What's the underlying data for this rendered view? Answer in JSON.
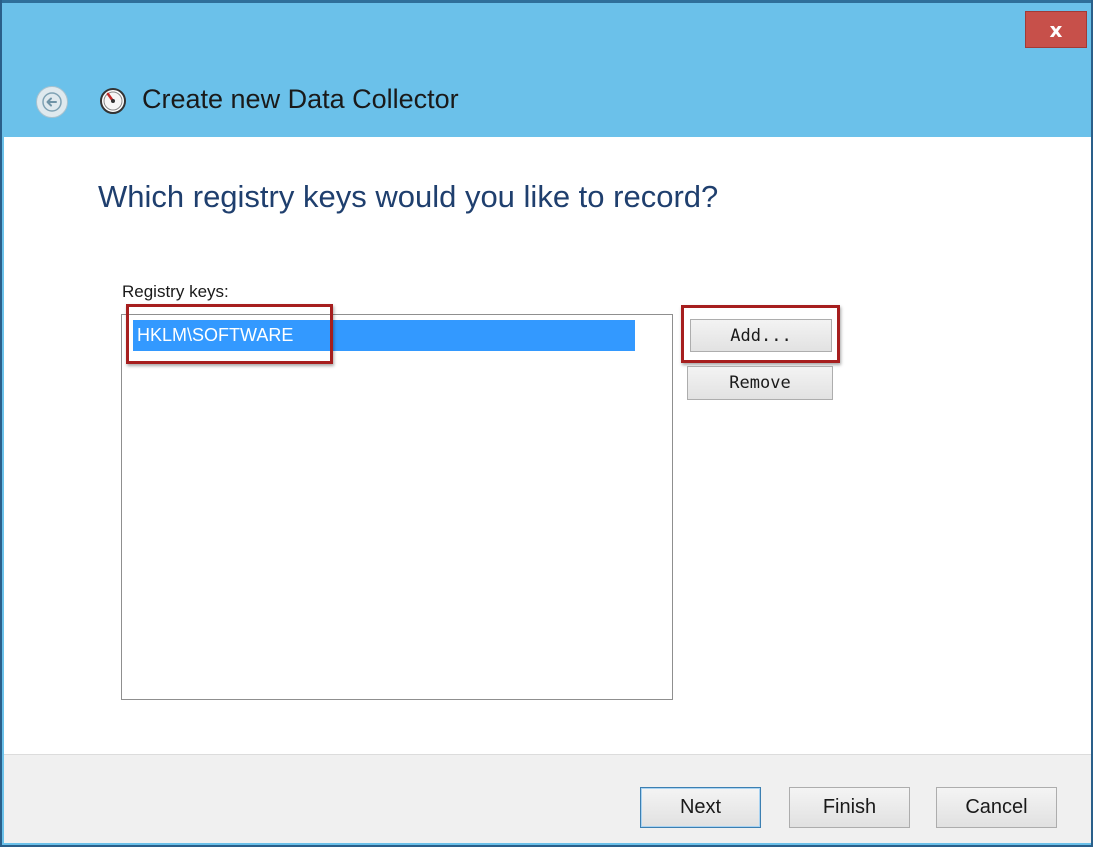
{
  "window": {
    "title": "Create new Data Collector",
    "close_label": "x",
    "frame_color": "#6bc1ea",
    "close_color": "#c7504a"
  },
  "icons": {
    "back": "back-arrow-icon",
    "app": "performance-monitor-icon"
  },
  "wizard": {
    "question": "Which registry keys would you like to record?",
    "list_label": "Registry keys:",
    "keys": [
      "HKLM\\SOFTWARE"
    ],
    "add_label": "Add...",
    "remove_label": "Remove"
  },
  "footer": {
    "next_label": "Next",
    "finish_label": "Finish",
    "cancel_label": "Cancel"
  },
  "colors": {
    "selection": "#3399ff",
    "heading": "#1f3f6e",
    "annotation": "#a61e1e"
  }
}
